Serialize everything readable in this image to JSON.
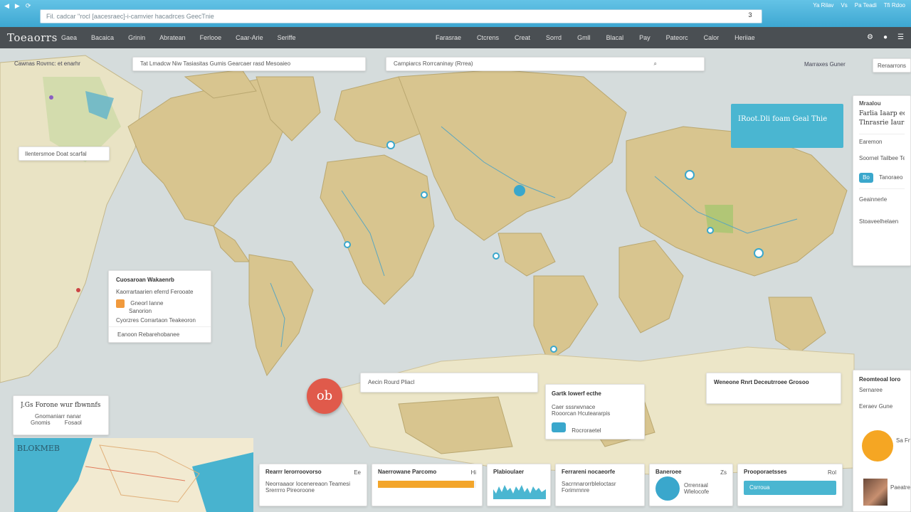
{
  "browser": {
    "nav": [
      "◀",
      "▶",
      "⟳"
    ],
    "url": "Fil. cadcar \"rocl [aacesraec]-i-camvier hacadrces GeecTnie",
    "page_num": "3",
    "window_controls": [
      "Ya Rilav",
      "Vs",
      "Pa Teadi",
      "Tfi Rdoo"
    ]
  },
  "header": {
    "logo": "Toeaorrs",
    "menu_left": [
      "Gaea",
      "Bacaica",
      "Grinin",
      "Abratean",
      "Ferlooe",
      "Caar-Arie",
      "Seriffe"
    ],
    "menu_right": [
      "Farasrae",
      "Ctcrens",
      "Creat",
      "Sorrd",
      "Gmll",
      "Blacal",
      "Pay",
      "Pateorc",
      "Calor",
      "Heriiae"
    ],
    "icons": [
      "settings-icon",
      "user-icon",
      "menu-icon"
    ]
  },
  "map": {
    "coords_label": "Cawnas Rovrnc: et enarhr",
    "search_primary": "Tat  Lmadcw  Niw  Tasiasitas  Gumis  Gearcaer  rasd  Mesoaieo",
    "search_secondary": "Carnpiarcs  Rorrcaninay  (Rrrea)",
    "right_label": "Marraxes Guner",
    "right_button": "Reraarrons",
    "region_label": "Ilentersmoe  Doat  scarfal"
  },
  "overlay": {
    "teal_card": "IRoot.Dli foam Geal Thie",
    "right_panel": {
      "title": "Mraalou",
      "big_lines": [
        "Farlia Iaarp ec Stnb",
        "Tlnrasrie Iaurs"
      ],
      "sub1": "Earemon",
      "sub2": "Soornel Tailbee Tenfomlas",
      "pill": "Bo",
      "pill_label": "Tanoraeo",
      "sub3": "Geainnerle",
      "sub4": "Stoaveelhelaen"
    },
    "info_card": {
      "title": "Cuosaroan Wakaenrb",
      "line1": "Kaorrartaarien eferrd Ferooate",
      "line2": "Gneorl Ianne",
      "line3": "Sanorion",
      "line4": "Cyorzres  Corrartaon Teakeoron",
      "footer": "Eanoon  Rebarehobanee"
    },
    "route_card": "Aecin   Rourd  Pliacl",
    "detail_card": {
      "title": "Gartk  Iowerf  ecthe",
      "line1": "Caer  sssrwvnace",
      "line2": "Rooorcan Hcuteararpis",
      "line3": "Rocroraetel"
    },
    "stat_strip": "Weneone  Rnrt  Deceutrroee  Grosoo",
    "left_card": {
      "title": "J.Gs Forone wur fbwnnfs",
      "line1": "Gnomaniarr nanar",
      "line2": "Gnomis",
      "line3": "Fosaol"
    },
    "mini_map_label": "BLOKMEB",
    "fab_label": "ob"
  },
  "bottom": {
    "c1": {
      "title": "Rearrr  Ierorroovorso",
      "num": "Ee",
      "line1": "Neorraaaor Iocenereaon Teamesi",
      "line2": "Srerrrro  Pireoroone"
    },
    "c2": {
      "title": "Naerrowane  Parcomo",
      "num": "Hi",
      "progress": 0.98
    },
    "c3": {
      "title": "Plabioulaer"
    },
    "c4": {
      "title": "Ferrareni  nocaeorfe",
      "line1": "Sacrnnarorrbleloctasr",
      "line2": "Forimrnnre"
    },
    "c5": {
      "title": "Baneroee",
      "num": "Zs",
      "line1": "Orrenraal",
      "line2": "Wlelocofe"
    },
    "c6": {
      "title": "Prooporaetsses",
      "num": "Rol",
      "button": "Csrroua"
    }
  },
  "weather": {
    "title": "Reomteoal Ioro",
    "line1": "Sernaree",
    "line2": "Eeraev Gune",
    "temp_label": "Sa  Fnarwrew Tearcera",
    "footer": "Paeatrerr  Nnoerfoarr"
  },
  "colors": {
    "land": "#d8c58f",
    "ocean": "#d5dcdc",
    "accent_teal": "#4ab6d1",
    "accent_orange": "#f3a52a",
    "fab_red": "#e05a4b"
  }
}
